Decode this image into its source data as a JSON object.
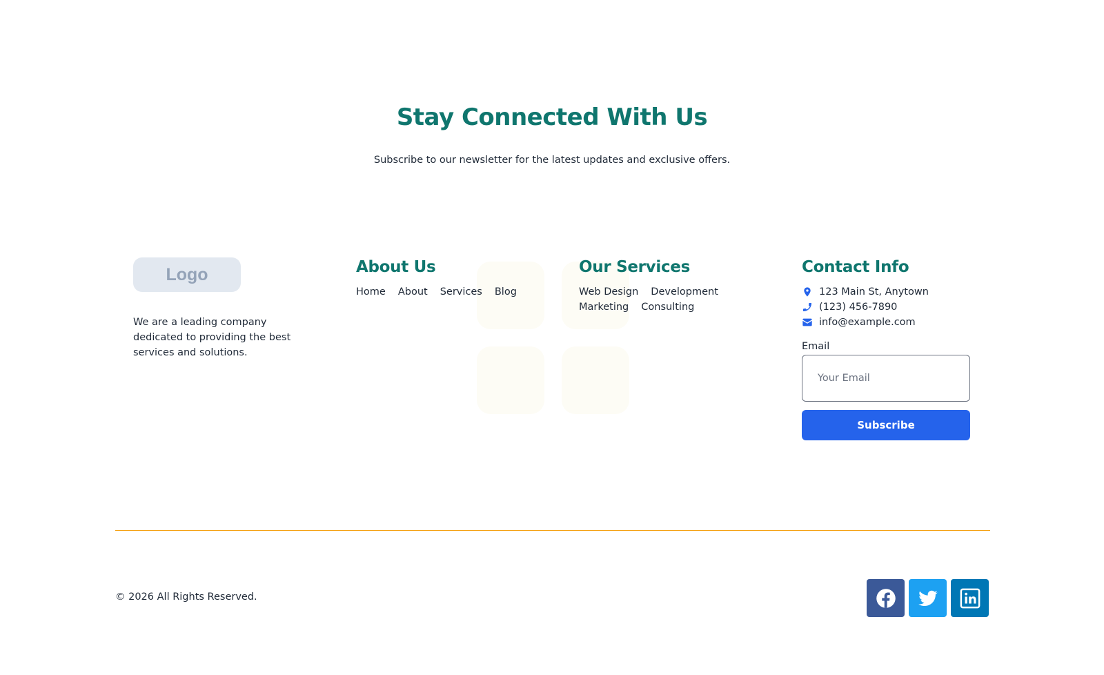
{
  "hero": {
    "title": "Stay Connected With Us",
    "subtitle": "Subscribe to our newsletter for the latest updates and exclusive offers."
  },
  "brand": {
    "logo_text": "Logo",
    "description": "We are a leading company dedicated to providing the best services and solutions."
  },
  "about": {
    "title": "About Us",
    "links": [
      "Home",
      "About",
      "Services",
      "Blog"
    ]
  },
  "services": {
    "title": "Our Services",
    "links": [
      "Web Design",
      "Development",
      "Marketing",
      "Consulting"
    ]
  },
  "contact": {
    "title": "Contact Info",
    "address": "123 Main St, Anytown",
    "phone": "(123) 456-7890",
    "email": "info@example.com",
    "form_label": "Email",
    "placeholder": "Your Email",
    "button_label": "Subscribe"
  },
  "footer": {
    "copyright": "© 2026 All Rights Reserved.",
    "socials": [
      {
        "name": "facebook-icon",
        "color": "#3b5998"
      },
      {
        "name": "twitter-icon",
        "color": "#1da1f2"
      },
      {
        "name": "linkedin-icon",
        "color": "#0077b5"
      }
    ]
  },
  "colors": {
    "heading": "#0f766e",
    "accent": "#2563eb",
    "divider": "#f59e0b"
  }
}
